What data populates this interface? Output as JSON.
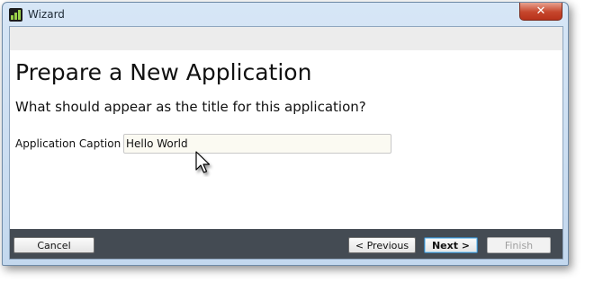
{
  "window": {
    "title": "Wizard",
    "close_glyph": "✕",
    "app_icon": "bar-chart-icon"
  },
  "page": {
    "heading": "Prepare a New Application",
    "question": "What should appear as the title for this application?"
  },
  "form": {
    "caption_label": "Application Caption",
    "caption_value": "Hello World"
  },
  "footer": {
    "cancel_label": "Cancel",
    "previous_label": "< Previous",
    "next_label": "Next >",
    "finish_label": "Finish"
  },
  "colors": {
    "footer_bg": "#444b53",
    "close_button": "#c6462c",
    "input_bg": "#fbfaf2"
  }
}
